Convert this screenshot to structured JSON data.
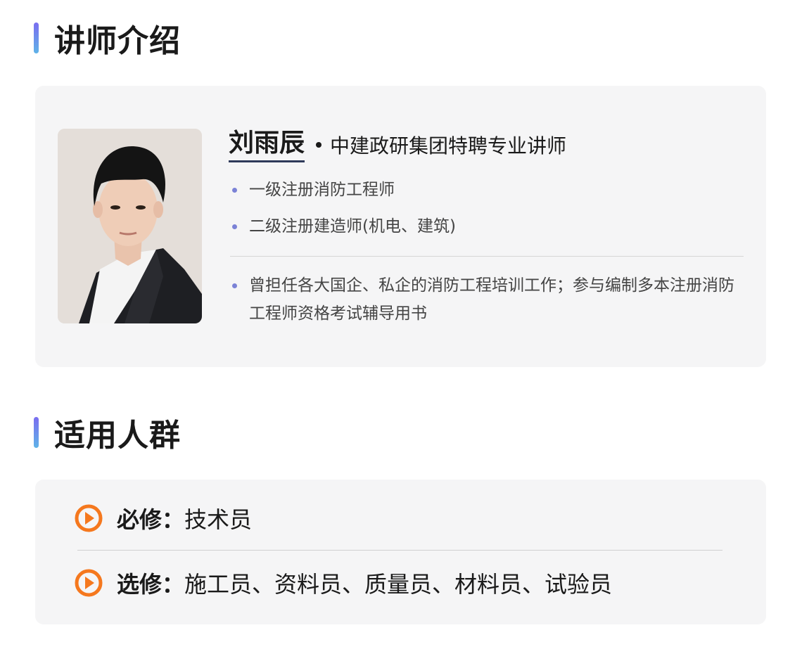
{
  "section1": {
    "title": "讲师介绍"
  },
  "instructor": {
    "name": "刘雨辰",
    "role": "中建政研集团特聘专业讲师",
    "qualifications": [
      "一级注册消防工程师",
      "二级注册建造师(机电、建筑)"
    ],
    "experience": "曾担任各大国企、私企的消防工程培训工作；参与编制多本注册消防工程师资格考试辅导用书"
  },
  "section2": {
    "title": "适用人群"
  },
  "audience": {
    "required_label": "必修：",
    "required_value": "技术员",
    "elective_label": "选修：",
    "elective_value": "施工员、资料员、质量员、材料员、试验员"
  },
  "colors": {
    "accent_orange": "#f5781e",
    "bullet_purple": "#7b82d6",
    "title_bar_top": "#7a6df0",
    "title_bar_bottom": "#5fb3e8"
  },
  "icons": {
    "play": "play-circle-icon"
  }
}
